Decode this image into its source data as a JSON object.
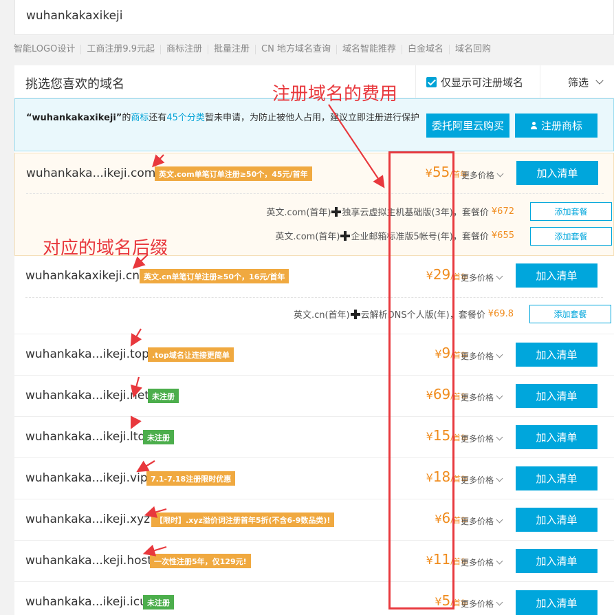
{
  "search": {
    "query": "wuhankakaxikeji"
  },
  "quicklinks": [
    "智能LOGO设计",
    "工商注册9.9元起",
    "商标注册",
    "批量注册",
    "CN 地方域名查询",
    "域名智能推荐",
    "白金域名",
    "域名回购"
  ],
  "panel": {
    "title": "挑选您喜欢的域名",
    "only_available_label": "仅显示可注册域名",
    "filter_label": "筛选"
  },
  "notice": {
    "brand": "“wuhankakaxikeji”",
    "t1": "的",
    "link1": "商标",
    "t2": "还有",
    "link2": "45个分类",
    "t3": "暂未申请，为防止被他人占用，建议立即注册进行保护",
    "entrust_button": "委托阿里云购买",
    "register_tm_button": "注册商标"
  },
  "common": {
    "more_prices": "更多价格",
    "add_to_list": "加入清单",
    "add_bundle": "添加套餐",
    "currency": "¥",
    "per_year": "/首年",
    "bundle_price_label": "套餐价"
  },
  "domains": [
    {
      "name": "wuhankaka...ikeji.com",
      "tag": "英文.com单笔订单注册≥50个，45元/首年",
      "tag_color": "orange",
      "price": "55"
    },
    {
      "name": "wuhankakaxikeji.cn",
      "tag": "英文.cn单笔订单注册≥50个，16元/首年",
      "tag_color": "orange",
      "price": "29"
    },
    {
      "name": "wuhankaka...ikeji.top",
      "tag": ".top域名让连接更简单",
      "tag_color": "orange",
      "price": "9"
    },
    {
      "name": "wuhankaka...ikeji.net",
      "tag": "未注册",
      "tag_color": "green",
      "price": "69"
    },
    {
      "name": "wuhankaka...ikeji.ltd",
      "tag": "未注册",
      "tag_color": "green",
      "price": "15"
    },
    {
      "name": "wuhankaka...ikeji.vip",
      "tag": "7.1-7.18注册限时优惠",
      "tag_color": "orange",
      "price": "18"
    },
    {
      "name": "wuhankaka...ikeji.xyz",
      "tag": "【限时】.xyz溢价词注册首年5折(不含6-9数品类)!",
      "tag_color": "orange",
      "price": "6"
    },
    {
      "name": "wuhankaka...keji.host",
      "tag": "一次性注册5年，仅129元!",
      "tag_color": "orange",
      "price": "11"
    },
    {
      "name": "wuhankaka...ikeji.icu",
      "tag": "未注册",
      "tag_color": "green",
      "price": "5"
    }
  ],
  "bundles": [
    {
      "part1": "英文.com(首年)",
      "part2": "独享云虚拟主机基础版(3年)，",
      "price": "¥672"
    },
    {
      "part1": "英文.com(首年)",
      "part2": "企业邮箱标准版5帐号(年)，",
      "price": "¥655"
    },
    {
      "part1": "英文.cn(首年)",
      "part2": "云解析DNS个人版(年)，",
      "price": "¥69.8"
    }
  ],
  "annotations": {
    "fee": "注册域名的费用",
    "suffix": "对应的域名后缀",
    "color": "#e8383d"
  }
}
